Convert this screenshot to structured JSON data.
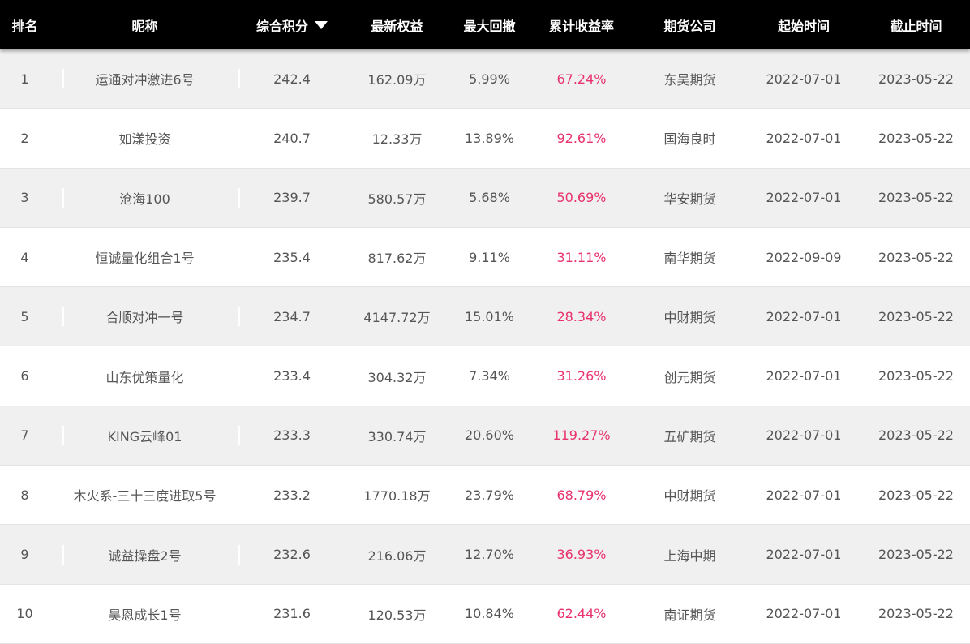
{
  "columns": {
    "rank": "排名",
    "name": "昵称",
    "score": "综合积分",
    "equity": "最新权益",
    "drawdown": "最大回撤",
    "return": "累计收益率",
    "firm": "期货公司",
    "start": "起始时间",
    "end": "截止时间"
  },
  "sort_icon": "caret-down-icon",
  "colors": {
    "header_bg": "#000000",
    "return_text": "#e8336d",
    "row_alt": "#f0f0f0"
  },
  "rows": [
    {
      "rank": "1",
      "name": "运通对冲激进6号",
      "score": "242.4",
      "equity": "162.09万",
      "drawdown": "5.99%",
      "return": "67.24%",
      "firm": "东吴期货",
      "start": "2022-07-01",
      "end": "2023-05-22"
    },
    {
      "rank": "2",
      "name": "如漾投资",
      "score": "240.7",
      "equity": "12.33万",
      "drawdown": "13.89%",
      "return": "92.61%",
      "firm": "国海良时",
      "start": "2022-07-01",
      "end": "2023-05-22"
    },
    {
      "rank": "3",
      "name": "沧海100",
      "score": "239.7",
      "equity": "580.57万",
      "drawdown": "5.68%",
      "return": "50.69%",
      "firm": "华安期货",
      "start": "2022-07-01",
      "end": "2023-05-22"
    },
    {
      "rank": "4",
      "name": "恒诚量化组合1号",
      "score": "235.4",
      "equity": "817.62万",
      "drawdown": "9.11%",
      "return": "31.11%",
      "firm": "南华期货",
      "start": "2022-09-09",
      "end": "2023-05-22"
    },
    {
      "rank": "5",
      "name": "合顺对冲一号",
      "score": "234.7",
      "equity": "4147.72万",
      "drawdown": "15.01%",
      "return": "28.34%",
      "firm": "中财期货",
      "start": "2022-07-01",
      "end": "2023-05-22"
    },
    {
      "rank": "6",
      "name": "山东优策量化",
      "score": "233.4",
      "equity": "304.32万",
      "drawdown": "7.34%",
      "return": "31.26%",
      "firm": "创元期货",
      "start": "2022-07-01",
      "end": "2023-05-22"
    },
    {
      "rank": "7",
      "name": "KING云峰01",
      "score": "233.3",
      "equity": "330.74万",
      "drawdown": "20.60%",
      "return": "119.27%",
      "firm": "五矿期货",
      "start": "2022-07-01",
      "end": "2023-05-22"
    },
    {
      "rank": "8",
      "name": "木火系-三十三度进取5号",
      "score": "233.2",
      "equity": "1770.18万",
      "drawdown": "23.79%",
      "return": "68.79%",
      "firm": "中财期货",
      "start": "2022-07-01",
      "end": "2023-05-22"
    },
    {
      "rank": "9",
      "name": "诚益操盘2号",
      "score": "232.6",
      "equity": "216.06万",
      "drawdown": "12.70%",
      "return": "36.93%",
      "firm": "上海中期",
      "start": "2022-07-01",
      "end": "2023-05-22"
    },
    {
      "rank": "10",
      "name": "昊恩成长1号",
      "score": "231.6",
      "equity": "120.53万",
      "drawdown": "10.84%",
      "return": "62.44%",
      "firm": "南证期货",
      "start": "2022-07-01",
      "end": "2023-05-22"
    }
  ]
}
